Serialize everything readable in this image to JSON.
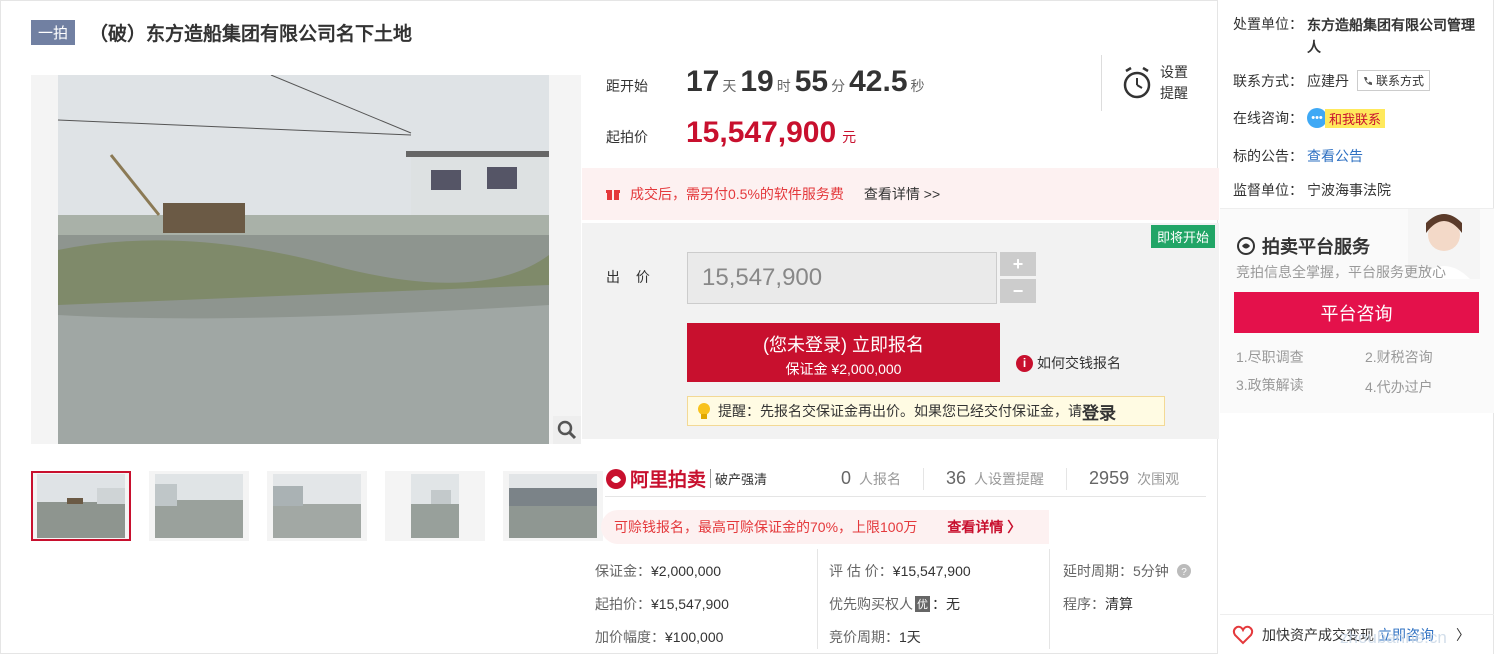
{
  "header": {
    "round_badge": "一拍",
    "title": "（破）东方造船集团有限公司名下土地"
  },
  "countdown": {
    "label": "距开始",
    "days": "17",
    "days_unit": "天",
    "hours": "19",
    "hours_unit": "时",
    "minutes": "55",
    "minutes_unit": "分",
    "seconds": "42.5",
    "seconds_unit": "秒"
  },
  "remind": {
    "line1": "设置",
    "line2": "提醒"
  },
  "start_price": {
    "label": "起拍价",
    "value": "15,547,900",
    "unit": "元"
  },
  "fee_notice": {
    "text": "成交后，需另付0.5%的软件服务费",
    "link": "查看详情 >>"
  },
  "bid": {
    "status_tag": "即将开始",
    "label": "出 价",
    "input_value": "15,547,900",
    "plus": "+",
    "minus": "−",
    "signup_main": "(您未登录) 立即报名",
    "signup_sub": "保证金 ¥2,000,000",
    "how_pay": "如何交钱报名",
    "tip_prefix": "提醒：先报名交保证金再出价。如果您已经交付保证金，请",
    "tip_login": "登录"
  },
  "platform": {
    "logo_name": "阿里拍卖",
    "logo_sub": "破产强清",
    "signups_num": "0",
    "signups_label": "人报名",
    "reminders_num": "36",
    "reminders_label": "人设置提醒",
    "views_num": "2959",
    "views_label": "次围观"
  },
  "loan": {
    "text": "可赊钱报名，最高可赊保证金的70%，上限100万",
    "link": "查看详情 〉"
  },
  "info": {
    "deposit_key": "保证金：",
    "deposit_val": "¥2,000,000",
    "start_key": "起拍价：",
    "start_val": "¥15,547,900",
    "increment_key": "加价幅度：",
    "increment_val": "¥100,000",
    "appraisal_key": "评 估 价：",
    "appraisal_val": "¥15,547,900",
    "priority_key": "优先购买权人",
    "priority_badge": "优",
    "priority_val": "：无",
    "period_key": "竞价周期：",
    "period_val": "1天",
    "delay_key": "延时周期：",
    "delay_val": "5分钟",
    "procedure_key": "程序：",
    "procedure_val": "清算"
  },
  "side": {
    "unit_key": "处置单位：",
    "unit_val": "东方造船集团有限公司管理人",
    "contact_key": "联系方式：",
    "contact_val": "应建丹",
    "contact_btn": "联系方式",
    "chat_key": "在线咨询：",
    "chat_btn": "和我联系",
    "notice_key": "标的公告：",
    "notice_link": "查看公告",
    "supervisor_key": "监督单位：",
    "supervisor_val": "宁波海事法院"
  },
  "service": {
    "title": "拍卖平台服务",
    "subtitle": "竞拍信息全掌握，平台服务更放心",
    "button": "平台咨询",
    "items": [
      "1.尽职调查",
      "2.财税咨询",
      "3.政策解读",
      "4.代办过户"
    ]
  },
  "bottom": {
    "text": "加快资产成交变现",
    "link": "立即咨询",
    "arrow": "〉"
  },
  "watermark": "zhoubarine.cn",
  "colors": {
    "accent": "#c8102e",
    "badge": "#7180a2",
    "green_tag": "#21a566",
    "link": "#2e70c2"
  },
  "icons": [
    "zoom-icon",
    "alarm-clock-icon",
    "gift-icon",
    "info-icon",
    "bulb-icon",
    "phone-icon",
    "chat-icon",
    "question-icon",
    "service-icon",
    "heart-help-icon"
  ]
}
